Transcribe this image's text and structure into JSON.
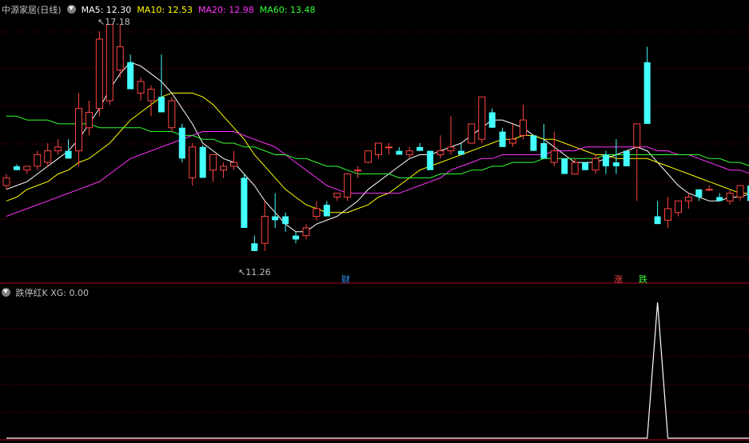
{
  "main_panel": {
    "title": "中源家居(日线)",
    "ma_legend": [
      {
        "name": "MA5",
        "value": "12.30",
        "color": "#ffffff"
      },
      {
        "name": "MA10",
        "value": "12.53",
        "color": "#ffff00"
      },
      {
        "name": "MA20",
        "value": "12.98",
        "color": "#ff33ff"
      },
      {
        "name": "MA60",
        "value": "13.48",
        "color": "#33ff33"
      }
    ],
    "high_label": "17.18",
    "low_label": "11.26",
    "markers": [
      {
        "text": "财",
        "color": "#3399ff"
      },
      {
        "text": "涨",
        "color": "#ff4444"
      },
      {
        "text": "跌",
        "color": "#33ff33"
      }
    ]
  },
  "indicator_panel": {
    "title": "跌停红K",
    "xg_name": "XG",
    "xg_value": "0.00"
  },
  "colors": {
    "up": "#ff4444",
    "down": "#44ffff",
    "grid": "#8b0000",
    "divider": "#b0001e",
    "text": "#c0c0c0"
  },
  "chart_data": [
    {
      "type": "candlestick",
      "title": "中源家居(日线)",
      "ylim": [
        10.8,
        17.4
      ],
      "series": [
        {
          "name": "K",
          "ohlc": [
            [
              13.0,
              13.3,
              12.9,
              13.2
            ],
            [
              13.5,
              13.55,
              13.4,
              13.4
            ],
            [
              13.4,
              13.5,
              13.3,
              13.5
            ],
            [
              13.5,
              13.9,
              13.4,
              13.8
            ],
            [
              13.6,
              14.1,
              13.5,
              13.9
            ],
            [
              13.9,
              14.2,
              13.8,
              14.0
            ],
            [
              13.9,
              14.2,
              13.7,
              13.7
            ],
            [
              13.9,
              15.4,
              13.5,
              15.0
            ],
            [
              14.5,
              15.2,
              14.3,
              14.9
            ],
            [
              15.0,
              17.0,
              14.8,
              16.8
            ],
            [
              15.2,
              16.5,
              15.1,
              17.18
            ],
            [
              16.0,
              17.18,
              15.8,
              16.6
            ],
            [
              16.2,
              16.4,
              15.5,
              15.5
            ],
            [
              15.4,
              15.8,
              15.2,
              15.7
            ],
            [
              15.2,
              15.6,
              14.8,
              15.5
            ],
            [
              15.3,
              16.4,
              14.9,
              14.9
            ],
            [
              14.5,
              15.3,
              14.4,
              15.2
            ],
            [
              14.5,
              14.6,
              13.6,
              13.7
            ],
            [
              13.2,
              14.1,
              13.0,
              14.0
            ],
            [
              14.0,
              14.05,
              13.2,
              13.2
            ],
            [
              13.4,
              13.7,
              13.1,
              13.8
            ],
            [
              13.4,
              13.6,
              13.2,
              13.5
            ],
            [
              13.5,
              13.9,
              13.4,
              13.6
            ],
            [
              13.2,
              13.3,
              11.9,
              11.9
            ],
            [
              11.5,
              11.7,
              11.3,
              11.3
            ],
            [
              11.5,
              12.6,
              11.3,
              12.2
            ],
            [
              12.2,
              12.8,
              11.9,
              12.1
            ],
            [
              12.2,
              12.3,
              11.8,
              12.0
            ],
            [
              11.7,
              11.8,
              11.5,
              11.6
            ],
            [
              11.7,
              12.0,
              11.6,
              11.9
            ],
            [
              12.2,
              12.6,
              12.1,
              12.4
            ],
            [
              12.5,
              12.6,
              12.2,
              12.2
            ],
            [
              12.7,
              12.8,
              12.6,
              12.8
            ],
            [
              12.7,
              13.3,
              12.6,
              13.3
            ],
            [
              13.4,
              13.5,
              13.2,
              13.4
            ],
            [
              13.6,
              13.9,
              13.6,
              13.9
            ],
            [
              13.8,
              14.0,
              13.7,
              14.1
            ],
            [
              14.0,
              14.1,
              13.8,
              14.0
            ],
            [
              13.9,
              14.0,
              13.8,
              13.8
            ],
            [
              13.8,
              14.0,
              13.7,
              13.9
            ],
            [
              14.0,
              14.1,
              13.9,
              13.9
            ],
            [
              13.9,
              13.9,
              13.4,
              13.4
            ],
            [
              13.8,
              14.3,
              13.7,
              13.9
            ],
            [
              13.9,
              14.8,
              13.8,
              14.0
            ],
            [
              13.9,
              14.1,
              13.8,
              13.8
            ],
            [
              14.1,
              14.5,
              14.1,
              14.6
            ],
            [
              14.2,
              15.3,
              14.1,
              15.3
            ],
            [
              14.9,
              15.0,
              14.5,
              14.5
            ],
            [
              14.4,
              14.5,
              14.0,
              14.0
            ],
            [
              14.1,
              14.6,
              14.0,
              14.2
            ],
            [
              14.3,
              15.1,
              14.2,
              14.7
            ],
            [
              14.3,
              14.3,
              13.9,
              13.9
            ],
            [
              14.1,
              14.6,
              13.7,
              13.7
            ],
            [
              13.6,
              14.4,
              13.5,
              13.9
            ],
            [
              13.7,
              13.7,
              13.3,
              13.3
            ],
            [
              13.3,
              13.7,
              13.3,
              13.6
            ],
            [
              13.6,
              13.6,
              13.4,
              13.4
            ],
            [
              13.4,
              13.8,
              13.3,
              13.7
            ],
            [
              13.8,
              13.9,
              13.3,
              13.5
            ],
            [
              13.6,
              14.2,
              13.3,
              13.5
            ],
            [
              13.9,
              13.9,
              13.5,
              13.5
            ],
            [
              14.0,
              14.6,
              12.6,
              14.6
            ],
            [
              16.2,
              16.6,
              14.6,
              14.6
            ],
            [
              12.2,
              12.6,
              12.0,
              12.0
            ],
            [
              12.1,
              12.7,
              11.9,
              12.4
            ],
            [
              12.3,
              12.6,
              12.2,
              12.6
            ],
            [
              12.6,
              12.8,
              12.4,
              12.7
            ],
            [
              12.9,
              12.9,
              12.6,
              12.7
            ],
            [
              12.9,
              13.0,
              12.9,
              12.9
            ],
            [
              12.7,
              12.8,
              12.6,
              12.6
            ],
            [
              12.6,
              12.9,
              12.5,
              12.8
            ],
            [
              12.7,
              12.9,
              12.6,
              13.0
            ],
            [
              13.0,
              13.1,
              12.6,
              12.6
            ]
          ]
        },
        {
          "name": "MA5",
          "values": [
            12.9,
            13.0,
            13.1,
            13.3,
            13.5,
            13.7,
            13.9,
            14.2,
            14.6,
            15.0,
            15.5,
            15.9,
            16.2,
            16.1,
            15.9,
            15.7,
            15.4,
            15.0,
            14.6,
            14.1,
            13.9,
            13.7,
            13.6,
            13.3,
            13.0,
            12.6,
            12.3,
            12.0,
            11.8,
            11.8,
            12.0,
            12.1,
            12.2,
            12.4,
            12.6,
            12.9,
            13.1,
            13.3,
            13.5,
            13.7,
            13.8,
            13.8,
            13.9,
            14.0,
            14.1,
            14.3,
            14.5,
            14.7,
            14.7,
            14.6,
            14.5,
            14.3,
            14.2,
            14.0,
            13.8,
            13.6,
            13.6,
            13.6,
            13.7,
            13.8,
            13.9,
            14.0,
            13.9,
            13.6,
            13.3,
            13.0,
            12.8,
            12.7,
            12.6,
            12.6,
            12.7,
            12.7,
            12.8
          ]
        },
        {
          "name": "MA10",
          "values": [
            12.6,
            12.7,
            12.9,
            13.0,
            13.1,
            13.3,
            13.4,
            13.6,
            13.7,
            13.9,
            14.1,
            14.4,
            14.7,
            14.9,
            15.1,
            15.3,
            15.4,
            15.4,
            15.4,
            15.3,
            15.1,
            14.8,
            14.5,
            14.2,
            13.8,
            13.5,
            13.2,
            12.9,
            12.7,
            12.5,
            12.4,
            12.3,
            12.3,
            12.3,
            12.4,
            12.5,
            12.7,
            12.8,
            13.0,
            13.2,
            13.4,
            13.5,
            13.6,
            13.7,
            13.8,
            13.9,
            14.0,
            14.1,
            14.2,
            14.2,
            14.3,
            14.3,
            14.2,
            14.2,
            14.1,
            14.0,
            13.9,
            13.8,
            13.8,
            13.7,
            13.7,
            13.7,
            13.7,
            13.6,
            13.5,
            13.4,
            13.3,
            13.2,
            13.1,
            13.0,
            12.9,
            12.8,
            12.8
          ]
        },
        {
          "name": "MA20",
          "values": [
            12.2,
            12.3,
            12.4,
            12.5,
            12.6,
            12.7,
            12.8,
            12.9,
            13.0,
            13.1,
            13.3,
            13.5,
            13.7,
            13.8,
            13.9,
            14.0,
            14.1,
            14.2,
            14.3,
            14.4,
            14.4,
            14.4,
            14.4,
            14.3,
            14.2,
            14.1,
            14.0,
            13.8,
            13.6,
            13.4,
            13.2,
            13.0,
            12.9,
            12.8,
            12.8,
            12.8,
            12.8,
            12.8,
            12.8,
            12.9,
            13.0,
            13.1,
            13.2,
            13.4,
            13.5,
            13.6,
            13.7,
            13.7,
            13.8,
            13.8,
            13.8,
            13.8,
            13.8,
            13.9,
            13.9,
            13.9,
            14.0,
            14.0,
            14.0,
            14.0,
            14.0,
            14.0,
            14.0,
            13.9,
            13.9,
            13.8,
            13.8,
            13.7,
            13.6,
            13.5,
            13.4,
            13.4,
            13.3
          ]
        },
        {
          "name": "MA60",
          "values": [
            14.8,
            14.8,
            14.7,
            14.7,
            14.7,
            14.6,
            14.6,
            14.6,
            14.6,
            14.5,
            14.5,
            14.5,
            14.5,
            14.5,
            14.4,
            14.4,
            14.4,
            14.3,
            14.3,
            14.2,
            14.2,
            14.1,
            14.1,
            14.0,
            14.0,
            13.9,
            13.8,
            13.8,
            13.7,
            13.7,
            13.6,
            13.5,
            13.5,
            13.4,
            13.3,
            13.3,
            13.3,
            13.3,
            13.2,
            13.2,
            13.2,
            13.2,
            13.3,
            13.3,
            13.3,
            13.4,
            13.4,
            13.5,
            13.5,
            13.6,
            13.6,
            13.6,
            13.7,
            13.7,
            13.7,
            13.7,
            13.7,
            13.7,
            13.8,
            13.8,
            13.8,
            13.8,
            13.8,
            13.8,
            13.8,
            13.8,
            13.8,
            13.8,
            13.7,
            13.7,
            13.6,
            13.6,
            13.5
          ]
        }
      ]
    },
    {
      "type": "line",
      "title": "跌停红K",
      "ylim": [
        0,
        1
      ],
      "series": [
        {
          "name": "XG",
          "values": [
            0,
            0,
            0,
            0,
            0,
            0,
            0,
            0,
            0,
            0,
            0,
            0,
            0,
            0,
            0,
            0,
            0,
            0,
            0,
            0,
            0,
            0,
            0,
            0,
            0,
            0,
            0,
            0,
            0,
            0,
            0,
            0,
            0,
            0,
            0,
            0,
            0,
            0,
            0,
            0,
            0,
            0,
            0,
            0,
            0,
            0,
            0,
            0,
            0,
            0,
            0,
            0,
            0,
            0,
            0,
            0,
            0,
            0,
            0,
            0,
            0,
            0,
            0,
            1,
            0,
            0,
            0,
            0,
            0,
            0,
            0,
            0,
            0
          ]
        }
      ]
    }
  ]
}
